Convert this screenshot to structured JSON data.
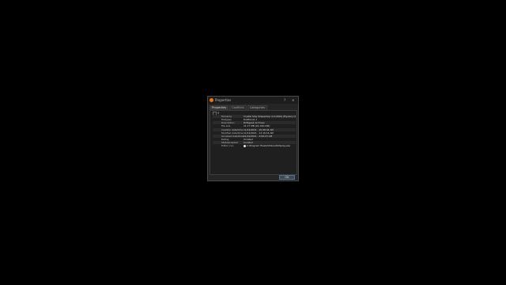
{
  "window": {
    "title": "Properties",
    "help_glyph": "?",
    "close_glyph": "✕"
  },
  "tabs": [
    {
      "label": "Properties"
    },
    {
      "label": "Conflicts"
    },
    {
      "label": "Categories"
    }
  ],
  "properties": [
    {
      "key": "Filename",
      "value": "Crystal Slay Shapeshop 4.9 (DOS) (Elysian) (SiN).dm"
    },
    {
      "key": "Filetypes",
      "value": "DosEmuls 1"
    },
    {
      "key": "Description",
      "value": "DOSgeek Archives"
    },
    {
      "key": "File size",
      "value": "21.17 MB (22,199,196)"
    },
    {
      "key": "Creation date/time",
      "value": "11/12/2021 - 10:08:44 AM"
    },
    {
      "key": "Modified date/time",
      "value": "11/12/2021 - 12:16:16 AM"
    },
    {
      "key": "Accessed date/time",
      "value": "11/12/2021 - 3:06:23 AM"
    },
    {
      "key": "Rating",
      "value": "Unrated"
    },
    {
      "key": "Status/Loaded",
      "value": "Unrated"
    },
    {
      "key": "Editor icon",
      "value": "C:\\Program Files\\DOSbox\\DOSplay.exe"
    }
  ],
  "ok_label": "OK"
}
